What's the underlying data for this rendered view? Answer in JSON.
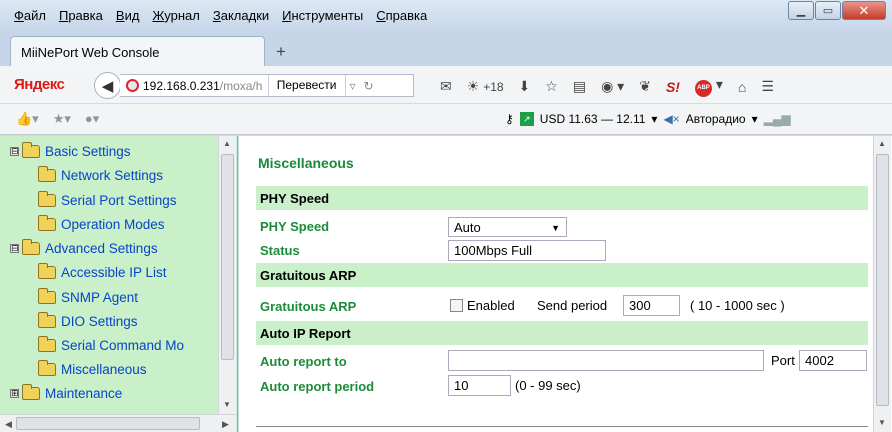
{
  "menu": [
    "Файл",
    "Правка",
    "Вид",
    "Журнал",
    "Закладки",
    "Инструменты",
    "Справка"
  ],
  "tab": {
    "title": "MiiNePort Web Console",
    "new_tab": "+"
  },
  "nav": {
    "brand": "Яндекс",
    "url_host": "192.168.0.231",
    "url_path": "/moxa/h",
    "translate": "Перевести",
    "weather": "+18"
  },
  "bookmarks": {
    "currency": "USD 11.63 — 12.11",
    "radio": "Авторадио"
  },
  "tree": [
    {
      "label": "Basic Settings",
      "level": 0,
      "expander": "⊟"
    },
    {
      "label": "Network Settings",
      "level": 1
    },
    {
      "label": "Serial Port Settings",
      "level": 1
    },
    {
      "label": "Operation Modes",
      "level": 1
    },
    {
      "label": "Advanced Settings",
      "level": 0,
      "expander": "⊟"
    },
    {
      "label": "Accessible IP List",
      "level": 1
    },
    {
      "label": "SNMP Agent",
      "level": 1
    },
    {
      "label": "DIO Settings",
      "level": 1
    },
    {
      "label": "Serial Command Mo",
      "level": 1
    },
    {
      "label": "Miscellaneous",
      "level": 1
    },
    {
      "label": "Maintenance",
      "level": 0,
      "expander": "⊞"
    }
  ],
  "main": {
    "title": "Miscellaneous",
    "phy": {
      "section": "PHY Speed",
      "speed_label": "PHY Speed",
      "speed_value": "Auto",
      "status_label": "Status",
      "status_value": "100Mbps Full"
    },
    "garp": {
      "section": "Gratuitous ARP",
      "label": "Gratuitous ARP",
      "enabled_label": "Enabled",
      "period_label": "Send period",
      "period_value": "300",
      "period_range": "( 10 - 1000 sec )"
    },
    "autoip": {
      "section": "Auto IP Report",
      "report_to_label": "Auto report to",
      "report_to_value": "",
      "port_label": "Port",
      "port_value": "4002",
      "period_label": "Auto report period",
      "period_value": "10",
      "period_range": "(0 - 99 sec)"
    }
  }
}
